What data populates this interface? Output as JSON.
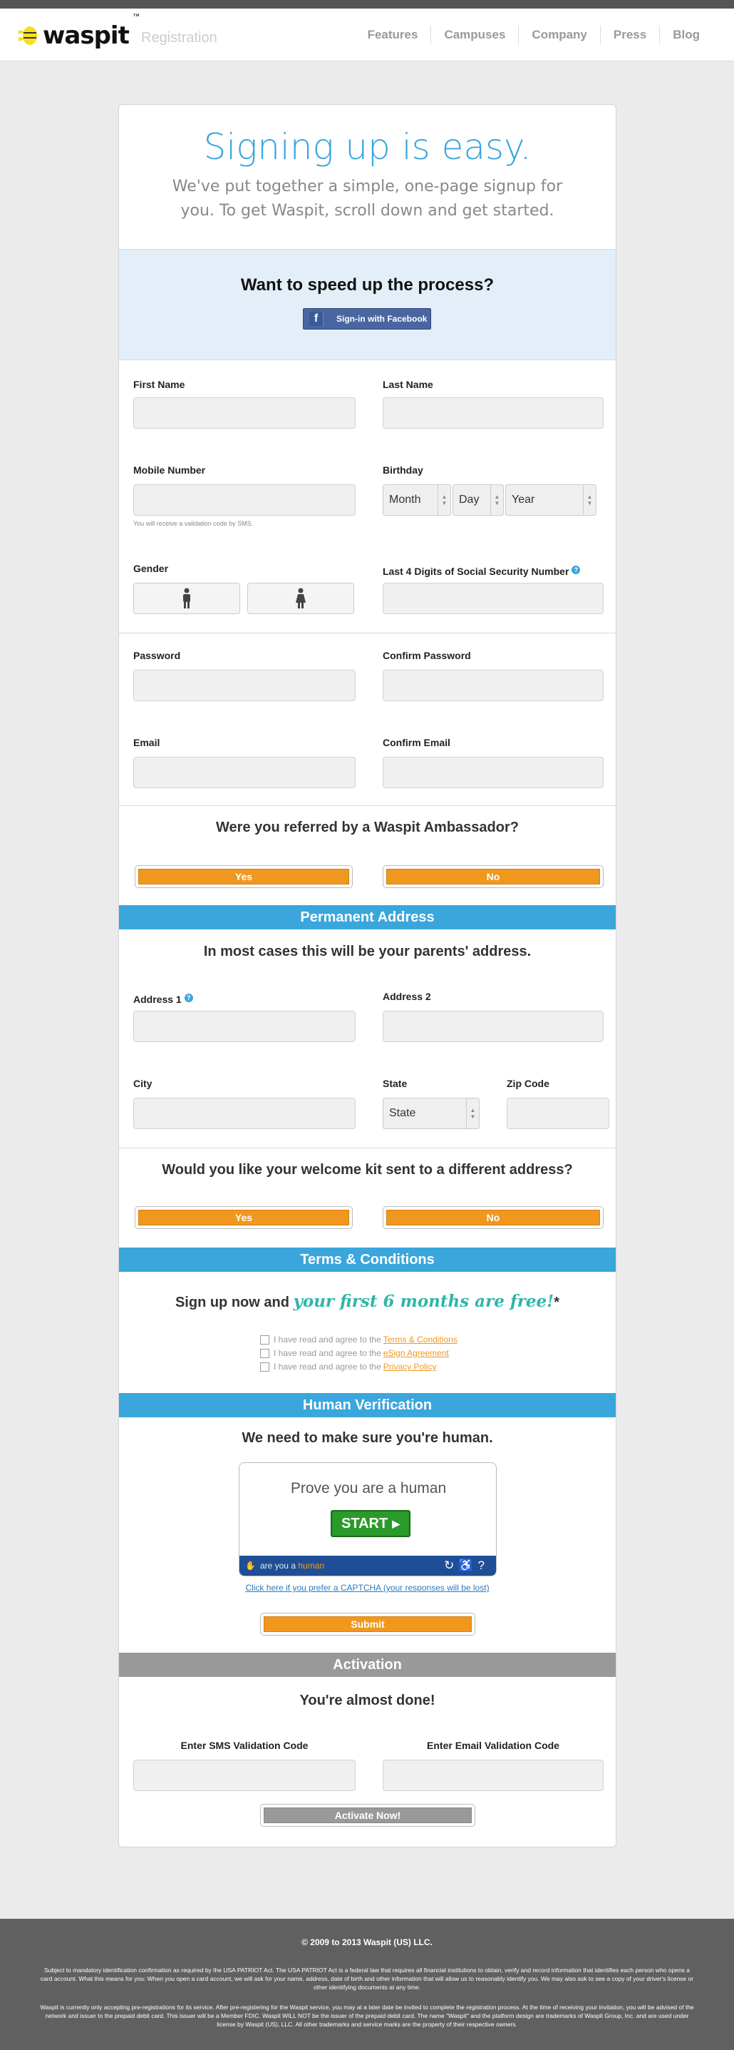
{
  "header": {
    "brand": "waspit",
    "tm": "™",
    "section": "Registration",
    "nav": [
      "Features",
      "Campuses",
      "Company",
      "Press",
      "Blog"
    ]
  },
  "hero": {
    "title": "Signing up is easy.",
    "subtitle": "We've put together a simple, one-page signup for you. To get Waspit, scroll down and get started."
  },
  "speed": {
    "title": "Want to speed up the process?",
    "facebook_label": "Sign-in with Facebook"
  },
  "form": {
    "first_name": "First Name",
    "last_name": "Last Name",
    "mobile": "Mobile Number",
    "mobile_note": "You will receive a validation code by SMS.",
    "birthday": "Birthday",
    "month": "Month",
    "day": "Day",
    "year": "Year",
    "gender": "Gender",
    "ssn": "Last 4 Digits of Social Security Number",
    "password": "Password",
    "confirm_password": "Confirm Password",
    "email": "Email",
    "confirm_email": "Confirm Email"
  },
  "ambassador": {
    "question": "Were you referred by a Waspit Ambassador?",
    "yes": "Yes",
    "no": "No"
  },
  "address": {
    "band": "Permanent Address",
    "note": "In most cases this will be your parents' address.",
    "address1": "Address 1",
    "address2": "Address 2",
    "city": "City",
    "state": "State",
    "state_value": "State",
    "zip": "Zip Code"
  },
  "kit": {
    "question": "Would you like your welcome kit sent to a different address?",
    "yes": "Yes",
    "no": "No"
  },
  "terms": {
    "band": "Terms & Conditions",
    "promo_lead": "Sign up now and",
    "promo_highlight": "your first 6 months are free!",
    "promo_star": "*",
    "agree_prefix": "I have read and agree to the",
    "link1": "Terms & Conditions",
    "link2": "eSign Agreement",
    "link3": "Privacy Policy"
  },
  "human": {
    "band": "Human Verification",
    "note": "We need to make sure you're human.",
    "prove": "Prove you are a human",
    "start": "START",
    "brand_a": "are you a",
    "brand_b": "human",
    "alt_link": "Click here if you prefer a CAPTCHA (your responses will be lost)",
    "submit": "Submit"
  },
  "activation": {
    "band": "Activation",
    "note": "You're almost done!",
    "sms_label": "Enter SMS Validation Code",
    "email_label": "Enter Email Validation Code",
    "button": "Activate Now!"
  },
  "footer": {
    "copyright": "© 2009 to 2013 Waspit (US) LLC.",
    "para1": "Subject to mandatory identification confirmation as required by the USA PATRIOT Act. The USA PATRIOT Act is a federal law that requires all financial institutions to obtain, verify and record information that identifies each person who opens a card account. What this means for you: When you open a card account, we will ask for your name, address, date of birth and other information that will allow us to reasonably identify you. We may also ask to see a copy of your driver's license or other identifying documents at any time.",
    "para2": "Waspit is currently only accepting pre-registrations for its service. After pre-registering for the Waspit service, you may at a later date be invited to complete the registration process. At the time of receiving your invitation, you will be advised of the network and issuer to the prepaid debit card. This issuer will be a Member FDIC. Waspit WILL NOT be the issuer of the prepaid debit card. The name \"Waspit\" and the platform design are trademarks of Waspit Group, Inc. and are used under license by Waspit (US), LLC. All other trademarks and service marks are the property of their respective owners."
  },
  "colors": {
    "accent": "#3aa6dc",
    "orange": "#f0981e",
    "teal": "#2fb6a8",
    "green": "#2a9a2a"
  }
}
